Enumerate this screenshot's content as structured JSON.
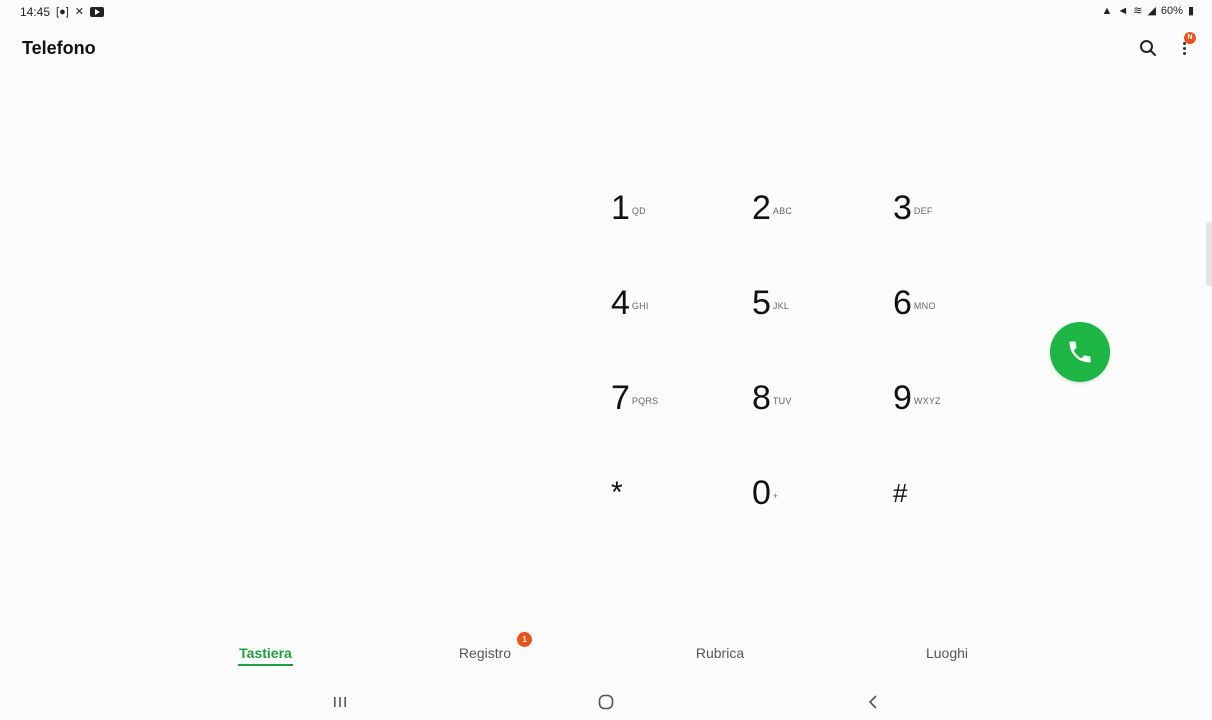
{
  "status_bar": {
    "time": "14:45",
    "battery": "60%"
  },
  "app_bar": {
    "title": "Telefono",
    "menu_badge": "N"
  },
  "keypad": {
    "keys": [
      {
        "digit": "1",
        "letters": "QD"
      },
      {
        "digit": "2",
        "letters": "ABC"
      },
      {
        "digit": "3",
        "letters": "DEF"
      },
      {
        "digit": "4",
        "letters": "GHI"
      },
      {
        "digit": "5",
        "letters": "JKL"
      },
      {
        "digit": "6",
        "letters": "MNO"
      },
      {
        "digit": "7",
        "letters": "PQRS"
      },
      {
        "digit": "8",
        "letters": "TUV"
      },
      {
        "digit": "9",
        "letters": "WXYZ"
      },
      {
        "digit": "*",
        "letters": ""
      },
      {
        "digit": "0",
        "letters": "+"
      },
      {
        "digit": "#",
        "letters": ""
      }
    ]
  },
  "tabs": [
    {
      "label": "Tastiera",
      "active": true
    },
    {
      "label": "Registro",
      "badge": "1"
    },
    {
      "label": "Rubrica"
    },
    {
      "label": "Luoghi"
    }
  ],
  "colors": {
    "accent": "#1e9c40",
    "call": "#1db544",
    "badge": "#e8541c"
  }
}
